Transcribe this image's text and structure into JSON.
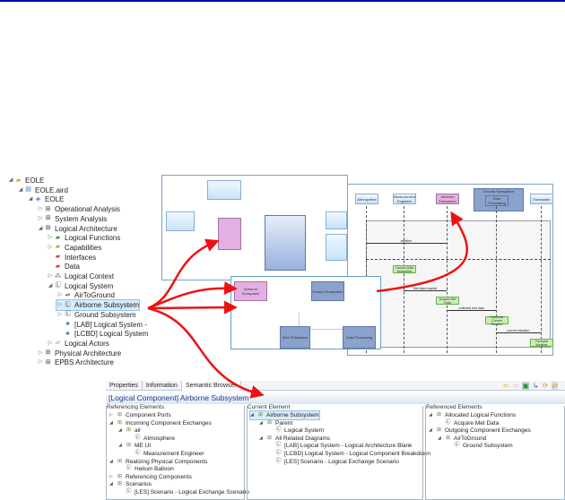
{
  "tree": [
    {
      "label": "EOLE",
      "depth": 0,
      "tw": "◢",
      "icon": "project-folder-icon"
    },
    {
      "label": "EOLE.aird",
      "depth": 1,
      "tw": "◢",
      "icon": "aird-file-icon"
    },
    {
      "label": "EOLE",
      "depth": 2,
      "tw": "◢",
      "icon": "model-icon"
    },
    {
      "label": "Operational Analysis",
      "depth": 3,
      "tw": "▷",
      "icon": "package-icon"
    },
    {
      "label": "System Analysis",
      "depth": 3,
      "tw": "▷",
      "icon": "package-icon"
    },
    {
      "label": "Logical Architecture",
      "depth": 3,
      "tw": "◢",
      "icon": "package-icon"
    },
    {
      "label": "Logical Functions",
      "depth": 4,
      "tw": "▷",
      "icon": "green-folder-icon"
    },
    {
      "label": "Capabilities",
      "depth": 4,
      "tw": "▷",
      "icon": "yellow-folder-icon"
    },
    {
      "label": "Interfaces",
      "depth": 4,
      "tw": "",
      "icon": "red-folder-icon"
    },
    {
      "label": "Data",
      "depth": 4,
      "tw": "",
      "icon": "red-folder-icon"
    },
    {
      "label": "Logical Context",
      "depth": 4,
      "tw": "▷",
      "icon": "context-diagram-icon"
    },
    {
      "label": "Logical System",
      "depth": 4,
      "tw": "◢",
      "icon": "logical-component-icon"
    },
    {
      "label": "AirToGround",
      "depth": 5,
      "tw": "▷",
      "icon": "exchange-icon"
    },
    {
      "label": "Airborne Subsystem",
      "depth": 5,
      "tw": "▷",
      "icon": "logical-component-icon",
      "selected": true
    },
    {
      "label": "Ground Subsystem",
      "depth": 5,
      "tw": "▷",
      "icon": "logical-component-icon"
    },
    {
      "label": "[LAB] Logical System -",
      "depth": 5,
      "tw": "",
      "icon": "diagram-icon"
    },
    {
      "label": "[LCBD] Logical System",
      "depth": 5,
      "tw": "",
      "icon": "diagram-icon"
    },
    {
      "label": "Logical Actors",
      "depth": 4,
      "tw": "▷",
      "icon": "folder-icon"
    },
    {
      "label": "Physical Architecture",
      "depth": 3,
      "tw": "▷",
      "icon": "package-icon"
    },
    {
      "label": "EPBS Architecture",
      "depth": 3,
      "tw": "▷",
      "icon": "package-icon"
    }
  ],
  "breakdown": {
    "airborne": "Airborne Subsystem",
    "ground": "Ground Subsystem",
    "web": "Web Publication",
    "data": "Data Processing"
  },
  "sequence": {
    "lifelines": [
      "Atmosphere",
      "Measurement Engineer",
      "Airborne Subsystem",
      "Data Processing",
      "Forecaster"
    ],
    "group": "Ground Subsystem",
    "messages": [
      "weather",
      "Met data request",
      "collected met data",
      "current situation"
    ],
    "functions": [
      "Launch Data Acquisition",
      "Acquire Met Data",
      "Elaborate Current Situation",
      "Forecast Weather"
    ]
  },
  "browser": {
    "tabs": [
      "Properties",
      "Information",
      "Semantic Browser"
    ],
    "title": "[Logical Component] Airborne Subsystem",
    "toolbar_icons": [
      "back-icon",
      "forward-icon",
      "diagram-icon",
      "link-icon",
      "refresh-icon",
      "sync-icon"
    ],
    "columns": [
      "Referencing Elements",
      "Current Element",
      "Referenced Elements"
    ],
    "referencing": [
      {
        "label": "Component Ports",
        "d": 0,
        "tw": "▷"
      },
      {
        "label": "Incoming Component Exchanges",
        "d": 0,
        "tw": "◢"
      },
      {
        "label": "air",
        "d": 1,
        "tw": "◢"
      },
      {
        "label": "Atmosphere",
        "d": 2,
        "tw": ""
      },
      {
        "label": "ME UI",
        "d": 1,
        "tw": "◢"
      },
      {
        "label": "Measurement Engineer",
        "d": 2,
        "tw": ""
      },
      {
        "label": "Realizing Physical Components",
        "d": 0,
        "tw": "◢"
      },
      {
        "label": "Helium Balloon",
        "d": 1,
        "tw": ""
      },
      {
        "label": "Referencing Components",
        "d": 0,
        "tw": "▷"
      },
      {
        "label": "Scenarios",
        "d": 0,
        "tw": "◢"
      },
      {
        "label": "[LES] Scenario - Logical Exchange Scenario",
        "d": 1,
        "tw": ""
      }
    ],
    "current": [
      {
        "label": "Airborne Subsystem",
        "d": 0,
        "tw": "◢",
        "sel": true
      },
      {
        "label": "Parent",
        "d": 1,
        "tw": "◢"
      },
      {
        "label": "Logical System",
        "d": 2,
        "tw": ""
      },
      {
        "label": "All Related Diagrams",
        "d": 1,
        "tw": "◢"
      },
      {
        "label": "[LAB] Logical System - Logical Architecture Blank",
        "d": 2,
        "tw": ""
      },
      {
        "label": "[LCBD] Logical System - Logical Component Breakdown",
        "d": 2,
        "tw": ""
      },
      {
        "label": "[LES] Scenario - Logical Exchange Scenario",
        "d": 2,
        "tw": ""
      }
    ],
    "referenced": [
      {
        "label": "Allocated Logical Functions",
        "d": 0,
        "tw": "◢"
      },
      {
        "label": "Acquire Met Data",
        "d": 1,
        "tw": ""
      },
      {
        "label": "Outgoing Component Exchanges",
        "d": 0,
        "tw": "◢"
      },
      {
        "label": "AirToGround",
        "d": 1,
        "tw": "◢"
      },
      {
        "label": "Ground Subsystem",
        "d": 2,
        "tw": ""
      }
    ]
  },
  "colors": {
    "accent": "#0000a8",
    "arrow": "#ee1111",
    "airborne": "#e4b0e4",
    "component": "#8aa2cc"
  }
}
